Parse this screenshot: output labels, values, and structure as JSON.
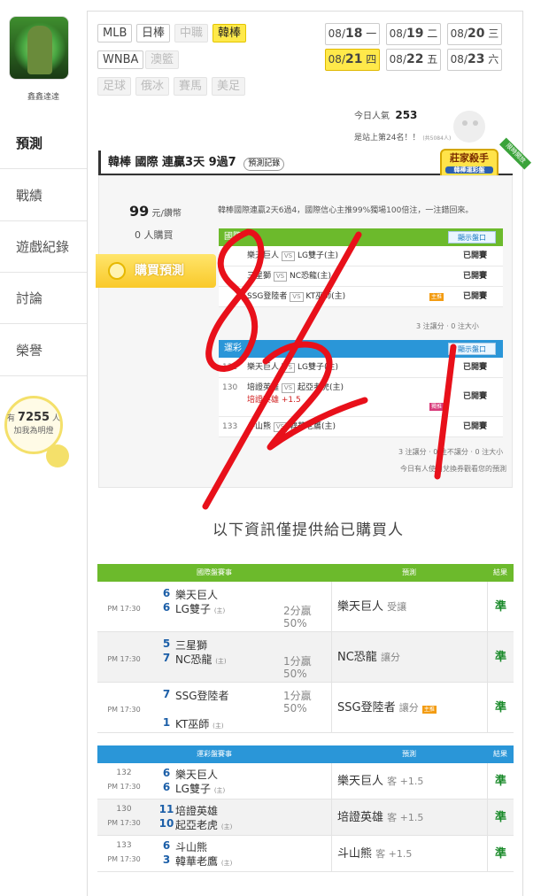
{
  "sidebar": {
    "username": "鑫鑫達達",
    "nav": [
      {
        "label": "預測"
      },
      {
        "label": "戰績"
      },
      {
        "label": "遊戲紀錄"
      },
      {
        "label": "討論"
      },
      {
        "label": "榮譽"
      }
    ],
    "fans_prefix": "有",
    "fans_count": "7255",
    "fans_suffix": "人",
    "fans_text": "加我為明燈"
  },
  "sports": {
    "row1": [
      "MLB",
      "日棒",
      "中職",
      "韓棒"
    ],
    "row2": [
      "WNBA",
      "澳籃"
    ],
    "row3": [
      "足球",
      "俄冰",
      "賽馬",
      "美足"
    ]
  },
  "dates": [
    {
      "d": "08/",
      "n": "18",
      "w": "一"
    },
    {
      "d": "08/",
      "n": "19",
      "w": "二"
    },
    {
      "d": "08/",
      "n": "20",
      "w": "三"
    },
    {
      "d": "08/",
      "n": "21",
      "w": "四"
    },
    {
      "d": "08/",
      "n": "22",
      "w": "五"
    },
    {
      "d": "08/",
      "n": "23",
      "w": "六"
    }
  ],
  "popularity": {
    "label": "今日人氣",
    "value": "253",
    "rank": "是站上第24名！！",
    "rank_note": "(共5084人)"
  },
  "header": {
    "title": "韓棒 國際 連贏3天 9過7",
    "record_btn": "預測記錄"
  },
  "badge": {
    "title": "莊家殺手",
    "sub": "韓棒運彩盤",
    "ribbon": "限時開放"
  },
  "preview": {
    "price": "99",
    "price_unit": "元/鑽幣",
    "buyers": "0",
    "buyers_label": "人購買",
    "buy_button": "購買預測",
    "summary": "韓棒國際連贏2天6過4，國際信心主推99%獨場100倍注，一注錯回來。",
    "intl_header": "國際",
    "intl_link": "顯示盤口",
    "intl_rows": [
      {
        "a": "樂天巨人",
        "b": "LG雙子(主)",
        "status": "已開賽"
      },
      {
        "a": "三星獅",
        "b": "NC恐龍(主)",
        "status": "已開賽"
      },
      {
        "a": "SSG登陸者",
        "b": "KT巫師(主)",
        "status": "已開賽",
        "tag": "主推"
      }
    ],
    "intl_foot": "3 注讓分 · 0 注大小",
    "sports_header": "運彩",
    "sports_link": "顯示盤口",
    "sports_rows": [
      {
        "no": "132",
        "a": "樂天巨人",
        "b": "LG雙子(主)",
        "status": "已開賽"
      },
      {
        "no": "130",
        "a": "培證英雄",
        "b": "起亞老虎(主)",
        "sub": "培證英雄 +1.5",
        "status": "已開賽",
        "tag": "獨推"
      },
      {
        "no": "133",
        "a": "斗山熊",
        "b": "韓華老鷹(主)",
        "status": "已開賽"
      }
    ],
    "sports_foot": "3 注讓分 · 0 注不讓分 · 0 注大小",
    "foot_note": "今日有人使用兌換券觀看您的預測"
  },
  "notice": "以下資訊僅提供給已購買人",
  "intl_table": {
    "headers": [
      "國際盤賽事",
      "預測",
      "結果"
    ],
    "rows": [
      {
        "time": "PM 17:30",
        "s1": "6",
        "t1": "樂天巨人",
        "s2": "6",
        "t2": "LG雙子",
        "home": "(主)",
        "hc": "2分贏",
        "hc2": "50%",
        "pred": "樂天巨人",
        "pred_sub": "受讓",
        "res": "準"
      },
      {
        "time": "PM 17:30",
        "s1": "5",
        "t1": "三星獅",
        "s2": "7",
        "t2": "NC恐龍",
        "home": "(主)",
        "hc": "1分贏",
        "hc2": "50%",
        "pred": "NC恐龍",
        "pred_sub": "讓分",
        "res": "準"
      },
      {
        "time": "PM 17:30",
        "s1": "7",
        "t1": "SSG登陸者",
        "s2": "1",
        "t2": "KT巫師",
        "home": "(主)",
        "hc": "1分贏",
        "hc2": "50%",
        "pred": "SSG登陸者",
        "pred_sub": "讓分",
        "res": "準",
        "tag": "主推"
      }
    ]
  },
  "sports_table": {
    "headers": [
      "運彩盤賽事",
      "預測",
      "結果"
    ],
    "rows": [
      {
        "no": "132",
        "time": "PM 17:30",
        "s1": "6",
        "t1": "樂天巨人",
        "s2": "6",
        "t2": "LG雙子",
        "home": "(主)",
        "pred": "樂天巨人",
        "pred_sub": "客 +1.5",
        "res": "準"
      },
      {
        "no": "130",
        "time": "PM 17:30",
        "s1": "11",
        "t1": "培證英雄",
        "s2": "10",
        "t2": "起亞老虎",
        "home": "(主)",
        "pred": "培證英雄",
        "pred_sub": "客 +1.5",
        "res": "準"
      },
      {
        "no": "133",
        "time": "PM 17:30",
        "s1": "6",
        "t1": "斗山熊",
        "s2": "3",
        "t2": "韓華老鷹",
        "home": "(主)",
        "pred": "斗山熊",
        "pred_sub": "客 +1.5",
        "res": "準"
      }
    ]
  },
  "handwriting": "8/21",
  "colors": {
    "green": "#6cba2c",
    "blue": "#2a96d8",
    "yellow": "#ffe94a",
    "ink": "#e8101a"
  }
}
